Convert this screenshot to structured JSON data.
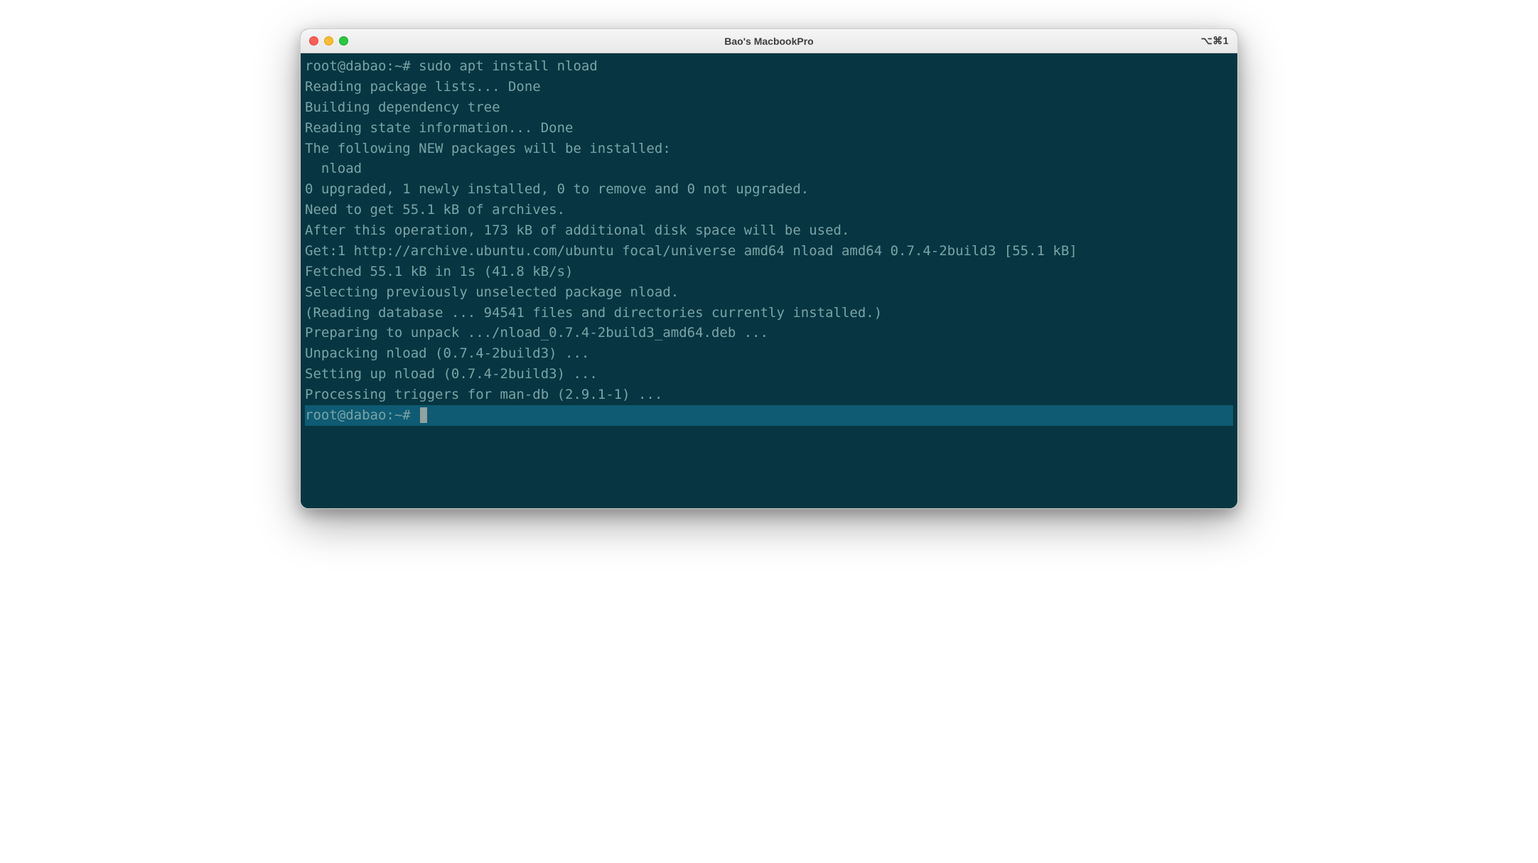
{
  "window": {
    "title": "Bao's MacbookPro",
    "hotkey": "⌥⌘1"
  },
  "terminal": {
    "prompt1": "root@dabao:~# ",
    "command": "sudo apt install nload",
    "lines": [
      "Reading package lists... Done",
      "Building dependency tree",
      "Reading state information... Done",
      "The following NEW packages will be installed:",
      "  nload",
      "0 upgraded, 1 newly installed, 0 to remove and 0 not upgraded.",
      "Need to get 55.1 kB of archives.",
      "After this operation, 173 kB of additional disk space will be used.",
      "Get:1 http://archive.ubuntu.com/ubuntu focal/universe amd64 nload amd64 0.7.4-2build3 [55.1 kB]",
      "Fetched 55.1 kB in 1s (41.8 kB/s)",
      "Selecting previously unselected package nload.",
      "(Reading database ... 94541 files and directories currently installed.)",
      "Preparing to unpack .../nload_0.7.4-2build3_amd64.deb ...",
      "Unpacking nload (0.7.4-2build3) ...",
      "Setting up nload (0.7.4-2build3) ...",
      "Processing triggers for man-db (2.9.1-1) ..."
    ],
    "prompt2": "root@dabao:~# "
  }
}
